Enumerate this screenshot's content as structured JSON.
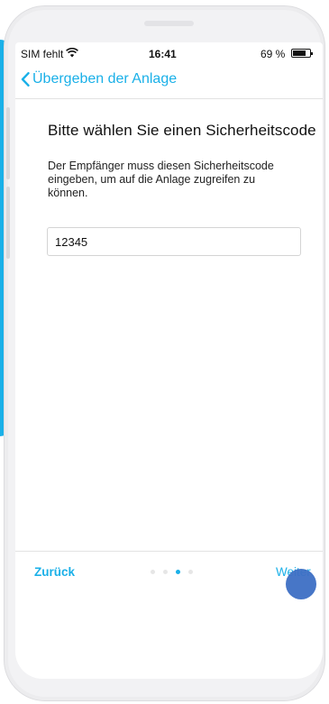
{
  "status_bar": {
    "carrier": "SIM fehlt",
    "wifi_icon": "wifi-icon",
    "time": "16:41",
    "battery_percent": "69 %",
    "battery_icon": "battery-icon",
    "battery_level": 0.69
  },
  "nav": {
    "back_icon": "chevron-left-icon",
    "title": "Übergeben der Anlage"
  },
  "main": {
    "heading": "Bitte wählen Sie einen Sicherheitscode",
    "description": "Der Empfänger muss diesen Sicherheitscode eingeben, um auf die Anlage zugreifen zu können.",
    "code_value": "12345"
  },
  "footer": {
    "back_label": "Zurück",
    "next_label": "Weiter",
    "page_count": 4,
    "active_page": 3
  },
  "colors": {
    "accent": "#1ab0e8",
    "touch_indicator": "#3d6fc4"
  }
}
